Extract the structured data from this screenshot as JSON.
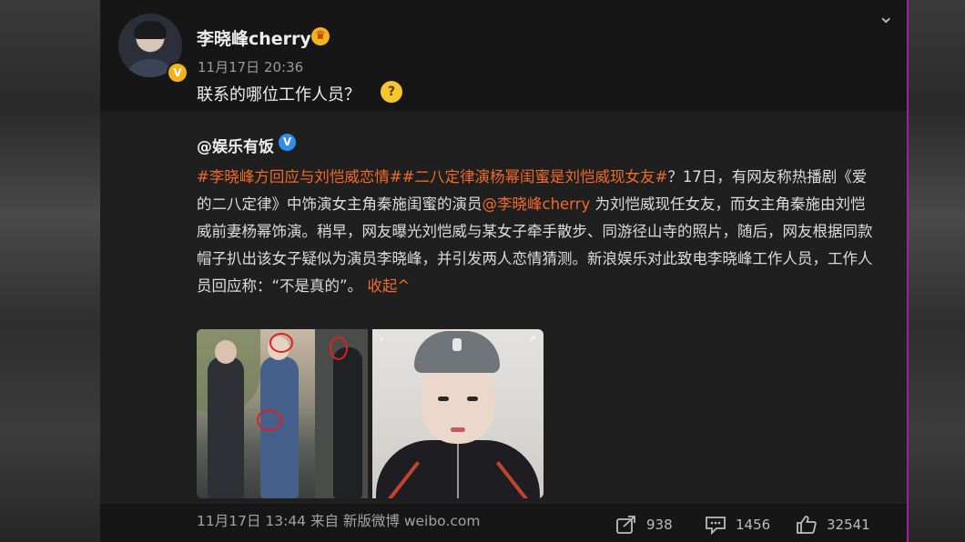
{
  "post": {
    "username": "李晓峰cherry",
    "timestamp": "11月17日 20:36",
    "text": "联系的哪位工作人员？"
  },
  "quoted": {
    "author": "@娱乐有饭",
    "tag1": "#李晓峰方回应与刘恺威恋情#",
    "tag2": "#二八定律演杨幂闺蜜是刘恺威现女友#",
    "body_part1": "？17日，有网友称热播剧《爱的二八定律》中饰演女主角秦施闺蜜的演员",
    "mention": "@李晓峰cherry",
    "body_part2": " 为刘恺威现任女友，而女主角秦施由刘恺威前妻杨幂饰演。稍早，网友曝光刘恺威与某女子牵手散步、同游径山寺的照片，随后，网友根据同款帽子扒出该女子疑似为演员李晓峰，并引发两人恋情猜测。新浪娱乐对此致电李晓峰工作人员，工作人员回应称：“不是真的”。",
    "collapse_label": "收起^",
    "meta": "11月17日 13:44 来自 新版微博 weibo.com",
    "actions": {
      "share_count": "938",
      "comment_count": "1456",
      "like_count": "32541"
    }
  },
  "colors": {
    "accent_link": "#f06a2a",
    "verified_gold": "#f2b21b",
    "verified_blue": "#2d8ef0",
    "background": "#161616",
    "quoted_background": "#1f1f1f"
  },
  "icons": {
    "expand": "chevron-down-icon",
    "share": "share-icon",
    "comment": "comment-icon",
    "like": "like-icon"
  }
}
